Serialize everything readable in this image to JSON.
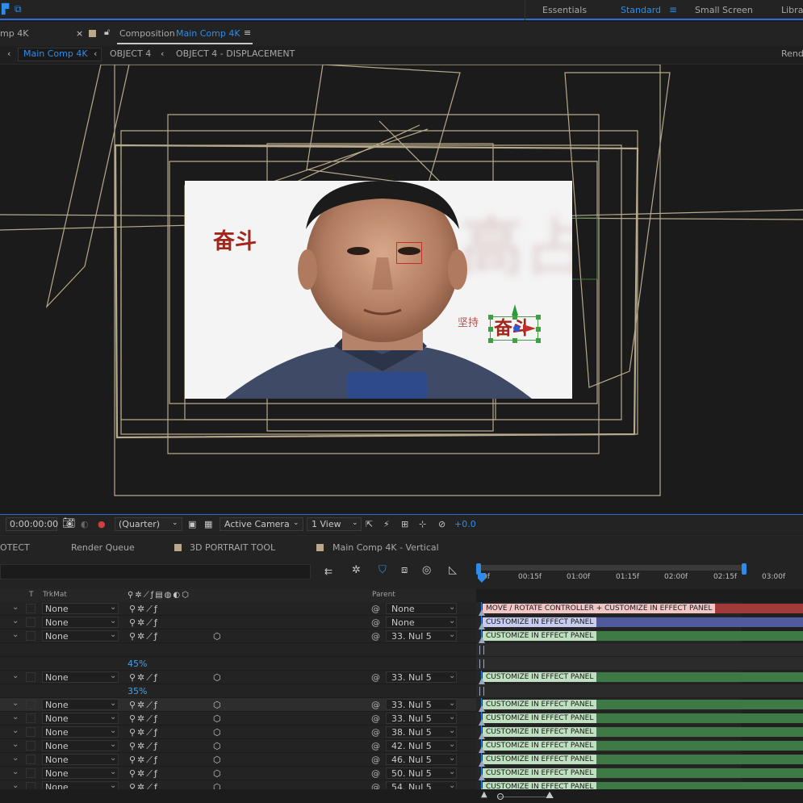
{
  "workspaces": [
    "Essentials",
    "Standard",
    "Small Screen",
    "Libra"
  ],
  "active_workspace": "Standard",
  "tabs": {
    "left_tab": "mp 4K",
    "comp_prefix": "Composition",
    "comp_name": "Main Comp 4K"
  },
  "breadcrumbs": [
    "Main Comp 4K",
    "OBJECT 4",
    "OBJECT 4 - DISPLACEMENT"
  ],
  "render_label": "Rend",
  "viewer": {
    "text_large": "奋斗",
    "text_small": "坚持",
    "text_selected": "奋斗"
  },
  "viewer_bar": {
    "timecode": "0:00:00:00",
    "resolution": "(Quarter)",
    "camera": "Active Camera",
    "views": "1 View",
    "exposure": "+0.0"
  },
  "panel_tabs": [
    "OTECT",
    "Render Queue",
    "3D PORTRAIT TOOL",
    "Main Comp 4K - Vertical"
  ],
  "ruler_ticks": [
    "0f",
    "00:15f",
    "01:00f",
    "01:15f",
    "02:00f",
    "02:15f",
    "03:00f"
  ],
  "columns": {
    "t": "T",
    "trkmat": "TrkMat",
    "parent": "Parent"
  },
  "layers": [
    {
      "type": "layer",
      "trkmat": "None",
      "parent": "None",
      "cube": false
    },
    {
      "type": "layer",
      "trkmat": "None",
      "parent": "None",
      "cube": false
    },
    {
      "type": "layer",
      "trkmat": "None",
      "parent": "33. Nul 5",
      "cube": true
    },
    {
      "type": "blank"
    },
    {
      "type": "pct",
      "value": "45",
      "unit": "%"
    },
    {
      "type": "layer",
      "trkmat": "None",
      "parent": "33. Nul 5",
      "cube": true
    },
    {
      "type": "pct",
      "value": "35",
      "unit": "%"
    },
    {
      "type": "layer",
      "trkmat": "None",
      "parent": "33. Nul 5",
      "cube": true
    },
    {
      "type": "layer",
      "trkmat": "None",
      "parent": "33. Nul 5",
      "cube": true
    },
    {
      "type": "layer",
      "trkmat": "None",
      "parent": "38. Nul 5",
      "cube": true
    },
    {
      "type": "layer",
      "trkmat": "None",
      "parent": "42. Nul 5",
      "cube": true
    },
    {
      "type": "layer",
      "trkmat": "None",
      "parent": "46. Nul 5",
      "cube": true
    },
    {
      "type": "layer",
      "trkmat": "None",
      "parent": "50. Nul 5",
      "cube": true
    },
    {
      "type": "layer",
      "trkmat": "None",
      "parent": "54. Nul 5",
      "cube": true
    }
  ],
  "bar_labels": {
    "controller": "MOVE / ROTATE CONTROLLER + CUSTOMIZE IN EFFECT PANEL",
    "effect": "CUSTOMIZE IN EFFECT PANEL"
  },
  "colors": {
    "accent": "#2d8ceb",
    "bar_red": "#a13b3b",
    "bar_blue": "#4f5b9e",
    "bar_green": "#3e7a45"
  }
}
